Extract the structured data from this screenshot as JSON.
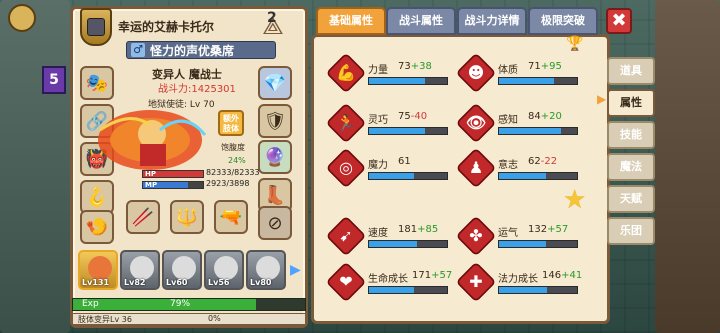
{
  "character": {
    "title": "幸运的艾赫卡托尔",
    "name": "怪力的声优桑席",
    "gender_symbol": "♂",
    "class_line": "变异人  魔战士",
    "power_line": "战斗力:1425301",
    "level_line": "地狱使徒: Lv 70",
    "extra_btn": "额外肢体",
    "satiety_label": "饱腹度",
    "satiety_value": "24%",
    "hp_label": "HP",
    "hp_text": "82333/82333",
    "hp_fraction": 1.0,
    "mp_label": "MP",
    "mp_text": "2923/3898",
    "mp_fraction": 0.75,
    "rank_num": "2"
  },
  "pets": [
    {
      "lv": "Lv131",
      "active": true
    },
    {
      "lv": "Lv82",
      "active": false
    },
    {
      "lv": "Lv60",
      "active": false
    },
    {
      "lv": "Lv56",
      "active": false
    },
    {
      "lv": "Lv80",
      "active": false
    }
  ],
  "exp": {
    "label": "Exp",
    "value": "79%",
    "fraction": 0.79,
    "skill_label": "肢体变异Lv 36",
    "skill_value": "0%"
  },
  "tabs": [
    {
      "label": "基础属性",
      "active": true
    },
    {
      "label": "战斗属性",
      "active": false
    },
    {
      "label": "战斗力详情",
      "active": false
    },
    {
      "label": "极限突破",
      "active": false
    }
  ],
  "side_tabs": [
    {
      "label": "道具",
      "active": false
    },
    {
      "label": "属性",
      "active": true
    },
    {
      "label": "技能",
      "active": false
    },
    {
      "label": "魔法",
      "active": false
    },
    {
      "label": "天赋",
      "active": false
    },
    {
      "label": "乐团",
      "active": false
    }
  ],
  "stats": [
    {
      "name": "力量",
      "value": "73",
      "bonus": "+38",
      "dir": "up",
      "fill": 0.72,
      "glyph": "💪"
    },
    {
      "name": "体质",
      "value": "71",
      "bonus": "+95",
      "dir": "up",
      "fill": 0.7,
      "glyph": "☻"
    },
    {
      "name": "灵巧",
      "value": "75",
      "bonus": "-40",
      "dir": "down",
      "fill": 0.72,
      "glyph": "🏃"
    },
    {
      "name": "感知",
      "value": "84",
      "bonus": "+20",
      "dir": "up",
      "fill": 0.8,
      "glyph": "👁"
    },
    {
      "name": "魔力",
      "value": "61",
      "bonus": "",
      "dir": "up",
      "fill": 0.58,
      "glyph": "◎"
    },
    {
      "name": "意志",
      "value": "62",
      "bonus": "-22",
      "dir": "down",
      "fill": 0.6,
      "glyph": "♟"
    },
    {
      "name": "速度",
      "value": "181",
      "bonus": "+85",
      "dir": "up",
      "fill": 0.62,
      "glyph": "➹"
    },
    {
      "name": "运气",
      "value": "132",
      "bonus": "+57",
      "dir": "up",
      "fill": 0.6,
      "glyph": "✤"
    },
    {
      "name": "生命成长",
      "value": "171",
      "bonus": "+57",
      "dir": "up",
      "fill": 0.58,
      "glyph": "❤"
    },
    {
      "name": "法力成长",
      "value": "146",
      "bonus": "+41",
      "dir": "up",
      "fill": 0.62,
      "glyph": "✚"
    }
  ],
  "icons": {
    "close": "✖",
    "star": "★",
    "hanger": "⌂",
    "arrow": "▶",
    "trophy": "♛"
  },
  "colors": {
    "accent_orange": "#f2a23a",
    "stat_red": "#c0282a",
    "bar_blue": "#3aa0e8",
    "up_green": "#2a9a2a",
    "down_red": "#d23a3a"
  },
  "hud": {
    "level_badge": "5"
  }
}
